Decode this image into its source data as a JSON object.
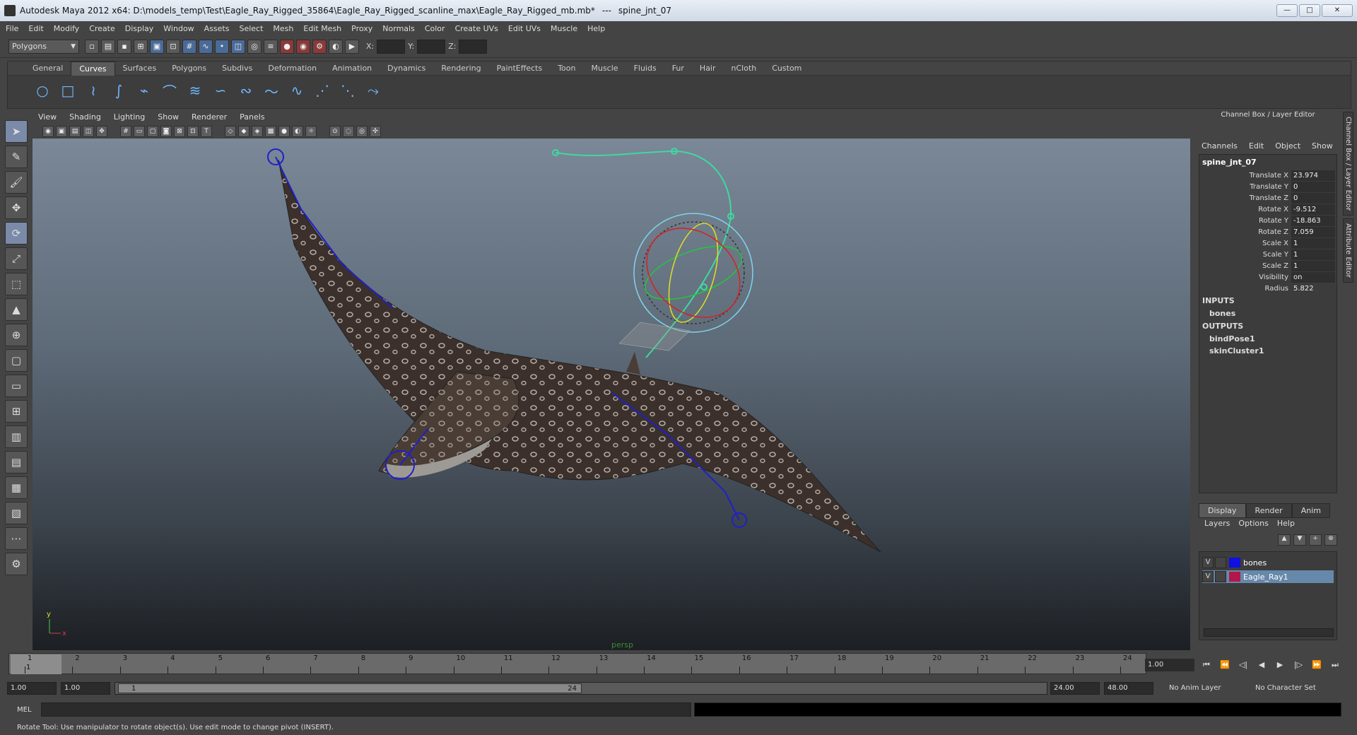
{
  "window": {
    "title": "Autodesk Maya 2012 x64: D:\\models_temp\\Test\\Eagle_Ray_Rigged_35864\\Eagle_Ray_Rigged_scanline_max\\Eagle_Ray_Rigged_mb.mb*",
    "separator": "---",
    "selected_object": "spine_jnt_07",
    "min_label": "—",
    "max_label": "□",
    "close_label": "✕"
  },
  "menubar": [
    "File",
    "Edit",
    "Modify",
    "Create",
    "Display",
    "Window",
    "Assets",
    "Select",
    "Mesh",
    "Edit Mesh",
    "Proxy",
    "Normals",
    "Color",
    "Create UVs",
    "Edit UVs",
    "Muscle",
    "Help"
  ],
  "status_line": {
    "mode": "Polygons",
    "x_label": "X:",
    "y_label": "Y:",
    "z_label": "Z:"
  },
  "shelf": {
    "tabs": [
      "General",
      "Curves",
      "Surfaces",
      "Polygons",
      "Subdivs",
      "Deformation",
      "Animation",
      "Dynamics",
      "Rendering",
      "PaintEffects",
      "Toon",
      "Muscle",
      "Fluids",
      "Fur",
      "Hair",
      "nCloth",
      "Custom"
    ],
    "active_tab": "Curves"
  },
  "viewport": {
    "menu": [
      "View",
      "Shading",
      "Lighting",
      "Show",
      "Renderer",
      "Panels"
    ],
    "camera": "persp",
    "colors": {
      "sky_top": "#7a8898",
      "floor": "#1c1f23",
      "ray_body": "#3b302b",
      "joint": "#2020c8",
      "tail": "#3fd9a0"
    }
  },
  "channel_box": {
    "title": "Channel Box / Layer Editor",
    "menu": [
      "Channels",
      "Edit",
      "Object",
      "Show"
    ],
    "node": "spine_jnt_07",
    "attributes": [
      {
        "name": "Translate X",
        "value": "23.974"
      },
      {
        "name": "Translate Y",
        "value": "0"
      },
      {
        "name": "Translate Z",
        "value": "0"
      },
      {
        "name": "Rotate X",
        "value": "-9.512"
      },
      {
        "name": "Rotate Y",
        "value": "-18.863"
      },
      {
        "name": "Rotate Z",
        "value": "7.059"
      },
      {
        "name": "Scale X",
        "value": "1"
      },
      {
        "name": "Scale Y",
        "value": "1"
      },
      {
        "name": "Scale Z",
        "value": "1"
      },
      {
        "name": "Visibility",
        "value": "on"
      },
      {
        "name": "Radius",
        "value": "5.822"
      }
    ],
    "inputs_label": "INPUTS",
    "inputs": [
      "bones"
    ],
    "outputs_label": "OUTPUTS",
    "outputs": [
      "bindPose1",
      "skinCluster1"
    ]
  },
  "side_tabs": [
    "Channel Box / Layer Editor",
    "Attribute Editor"
  ],
  "layer_editor": {
    "tabs": [
      "Display",
      "Render",
      "Anim"
    ],
    "menu": [
      "Layers",
      "Options",
      "Help"
    ],
    "layers": [
      {
        "vis": "V",
        "name": "bones",
        "color": "#1010e0",
        "selected": false
      },
      {
        "vis": "V",
        "name": "Eagle_Ray1",
        "color": "#b0184a",
        "selected": true
      }
    ]
  },
  "timeline": {
    "ticks": [
      "1",
      "2",
      "3",
      "4",
      "5",
      "6",
      "7",
      "8",
      "9",
      "10",
      "11",
      "12",
      "13",
      "14",
      "15",
      "16",
      "17",
      "18",
      "19",
      "20",
      "21",
      "22",
      "23",
      "24"
    ],
    "current_frame": "1",
    "current_frame_field": "1.00"
  },
  "range": {
    "start": "1.00",
    "playback_start": "1.00",
    "knob_start": "1",
    "knob_end": "24",
    "playback_end": "24.00",
    "end": "48.00",
    "anim_layer": "No Anim Layer",
    "char_set": "No Character Set"
  },
  "command_line": {
    "label": "MEL"
  },
  "help_line": "Rotate Tool: Use manipulator to rotate object(s). Use edit mode to change pivot (INSERT)."
}
